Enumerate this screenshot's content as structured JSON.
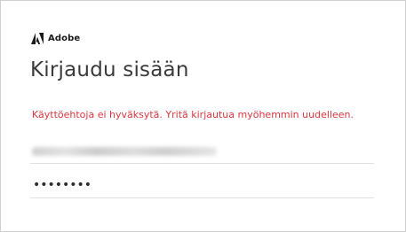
{
  "brand": {
    "name": "Adobe",
    "logo_icon": "adobe-logo-icon",
    "logo_color": "#1b1b1b"
  },
  "signin": {
    "title": "Kirjaudu sisään",
    "error_message": "Käyttöehtoja ei hyväksytä. Yritä kirjautua myöhemmin uudelleen.",
    "error_color": "#d7373f",
    "email_value_redacted": true,
    "password_mask": "••••••••"
  }
}
